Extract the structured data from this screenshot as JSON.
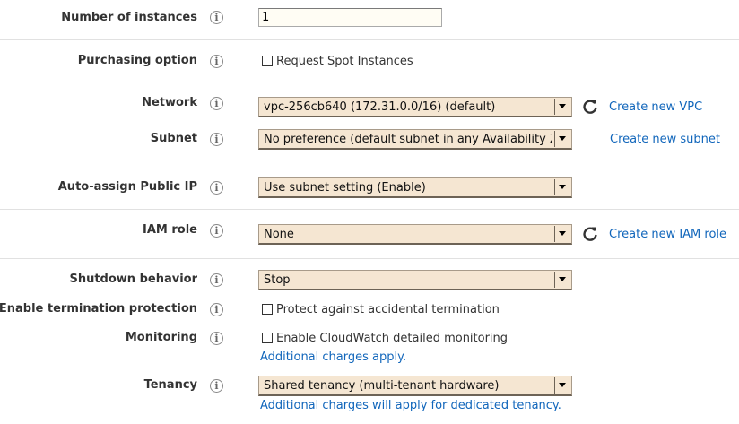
{
  "fields": {
    "instances": {
      "label": "Number of instances",
      "value": "1"
    },
    "purchasing": {
      "label": "Purchasing option",
      "checkbox_label": "Request Spot Instances"
    },
    "network": {
      "label": "Network",
      "value": "vpc-256cb640 (172.31.0.0/16) (default)",
      "link": "Create new VPC"
    },
    "subnet": {
      "label": "Subnet",
      "value": "No preference (default subnet in any Availability Zone)",
      "link": "Create new subnet"
    },
    "public_ip": {
      "label": "Auto-assign Public IP",
      "value": "Use subnet setting (Enable)"
    },
    "iam": {
      "label": "IAM role",
      "value": "None",
      "link": "Create new IAM role"
    },
    "shutdown": {
      "label": "Shutdown behavior",
      "value": "Stop"
    },
    "termination": {
      "label": "Enable termination protection",
      "checkbox_label": "Protect against accidental termination"
    },
    "monitoring": {
      "label": "Monitoring",
      "checkbox_label": "Enable CloudWatch detailed monitoring",
      "note_link": "Additional charges apply."
    },
    "tenancy": {
      "label": "Tenancy",
      "value": "Shared tenancy (multi-tenant hardware)",
      "note_link": "Additional charges will apply for dedicated tenancy."
    }
  },
  "icons": {
    "info": "info-icon",
    "refresh": "refresh-icon",
    "dropdown": "chevron-down-icon"
  },
  "colors": {
    "link": "#1166bb",
    "select_bg": "#f5e6d2",
    "divider": "#e1e1e1"
  }
}
